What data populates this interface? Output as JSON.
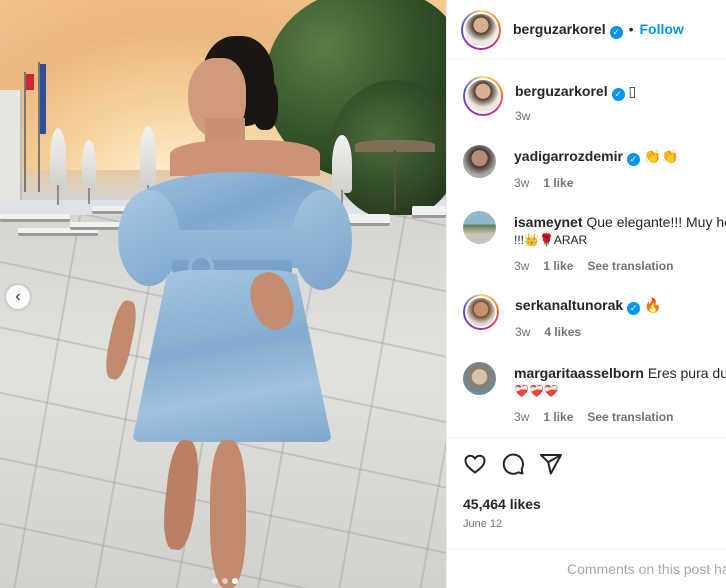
{
  "post": {
    "username": "berguzarkorel",
    "follow_label": "Follow",
    "caption_time": "3w",
    "caption_emoji": "▯",
    "likes": "45,464 likes",
    "date": "June 12",
    "comment_placeholder": "Comments on this post have been limited."
  },
  "carousel": {
    "current_index": 3,
    "total": 3
  },
  "comments": [
    {
      "username": "yadigarrozdemir",
      "verified": true,
      "text": "👏👏",
      "text2": "",
      "time": "3w",
      "likes": "1 like",
      "translate": ""
    },
    {
      "username": "isameynet",
      "verified": false,
      "text": "Que elegante!!! Muy hermosa",
      "text2": "!!!👑🌹ARAR",
      "time": "3w",
      "likes": "1 like",
      "translate": "See translation"
    },
    {
      "username": "serkanaltunorak",
      "verified": true,
      "text": "🔥",
      "text2": "",
      "time": "3w",
      "likes": "4 likes",
      "translate": ""
    },
    {
      "username": "margaritaasselborn",
      "verified": false,
      "text": "Eres pura dulzura",
      "text2": "❤️‍🩹❤️‍🩹❤️‍🩹",
      "time": "3w",
      "likes": "1 like",
      "translate": "See translation"
    }
  ],
  "icons": [
    "heart-icon",
    "comment-icon",
    "share-icon",
    "chevron-left-icon",
    "verified-icon"
  ],
  "colors": {
    "accent": "#0095f6",
    "muted": "#737373"
  }
}
